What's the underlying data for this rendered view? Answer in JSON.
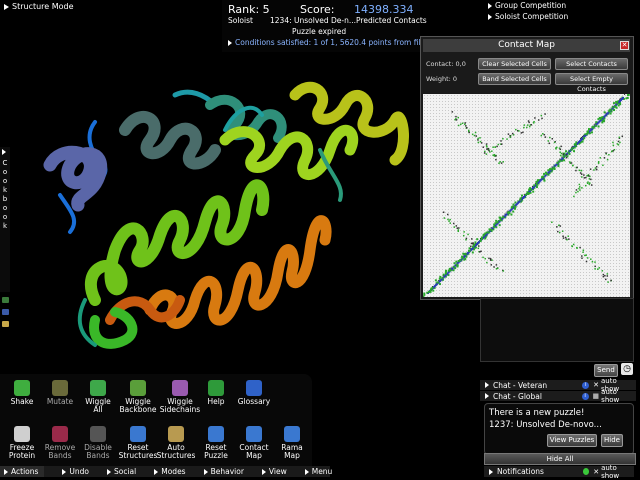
{
  "mode": {
    "label": "Structure Mode"
  },
  "score": {
    "rank_label": "Rank: 5",
    "score_label": "Score:",
    "score_value": "14398.334",
    "role": "Soloist",
    "puzzle": "1234: Unsolved De-n...Predicted Contacts",
    "status": "Puzzle expired",
    "conditions": "Conditions satisfied: 1 of 1, 5620.4 points from filters"
  },
  "competition": {
    "group": "Group Competition",
    "soloist": "Soloist Competition"
  },
  "cookbook": {
    "label": "Cookbook"
  },
  "contact_map": {
    "title": "Contact Map",
    "close_icon": "close-icon",
    "contact_label": "Contact: 0,0",
    "weight_label": "Weight: 0",
    "buttons": {
      "clear": "Clear Selected Cells",
      "select_contacts": "Select Contacts",
      "band": "Band Selected Cells",
      "select_empty": "Select Empty Contacts"
    }
  },
  "chat": {
    "send": "Send",
    "veteran": "Chat - Veteran",
    "global": "Chat - Global",
    "auto_show": "auto show",
    "notifications": "Notifications"
  },
  "notice": {
    "line1": "There is a new puzzle!",
    "line2": "1237: Unsolved De-novo...",
    "view_puzzles": "View Puzzles",
    "hide": "Hide",
    "hide_all": "Hide All"
  },
  "tools": {
    "row1": [
      {
        "id": "shake",
        "label": "Shake",
        "icon": "shake-icon",
        "color": "#3fae3f",
        "dim": false
      },
      {
        "id": "mutate",
        "label": "Mutate",
        "icon": "mutate-icon",
        "color": "#6a6a3a",
        "dim": true
      },
      {
        "id": "wiggle-all",
        "label": "Wiggle\nAll",
        "icon": "wiggle-all-icon",
        "color": "#3ea84a",
        "dim": false
      },
      {
        "id": "wiggle-backbone",
        "label": "Wiggle\nBackbone",
        "icon": "wiggle-backbone-icon",
        "color": "#5a9e3a",
        "dim": false
      },
      {
        "id": "wiggle-sidechains",
        "label": "Wiggle\nSidechains",
        "icon": "wiggle-sidechains-icon",
        "color": "#9a5ab0",
        "dim": false
      },
      {
        "id": "help",
        "label": "Help",
        "icon": "help-icon",
        "color": "#2e9a3a",
        "dim": false
      },
      {
        "id": "glossary",
        "label": "Glossary",
        "icon": "glossary-icon",
        "color": "#2f62c8",
        "dim": false
      }
    ],
    "row2": [
      {
        "id": "freeze-protein",
        "label": "Freeze\nProtein",
        "icon": "freeze-icon",
        "color": "#cfcfcf",
        "dim": false
      },
      {
        "id": "remove-bands",
        "label": "Remove\nBands",
        "icon": "remove-bands-icon",
        "color": "#9a2a4a",
        "dim": true
      },
      {
        "id": "disable-bands",
        "label": "Disable\nBands",
        "icon": "disable-bands-icon",
        "color": "#555555",
        "dim": true
      },
      {
        "id": "reset-structures",
        "label": "Reset\nStructures",
        "icon": "reset-structures-icon",
        "color": "#3a78d0",
        "dim": false
      },
      {
        "id": "auto-structures",
        "label": "Auto\nStructures",
        "icon": "auto-structures-icon",
        "color": "#b89a50",
        "dim": false
      },
      {
        "id": "reset-puzzle",
        "label": "Reset\nPuzzle",
        "icon": "reset-puzzle-icon",
        "color": "#3a78d0",
        "dim": false
      },
      {
        "id": "contact-map",
        "label": "Contact\nMap",
        "icon": "contact-map-icon",
        "color": "#3a78d0",
        "dim": false
      },
      {
        "id": "rama-map",
        "label": "Rama\nMap",
        "icon": "rama-map-icon",
        "color": "#3a78d0",
        "dim": false
      }
    ]
  },
  "menubar": {
    "actions": "Actions",
    "undo": "Undo",
    "social": "Social",
    "modes": "Modes",
    "behavior": "Behavior",
    "view": "View",
    "menu": "Menu"
  }
}
